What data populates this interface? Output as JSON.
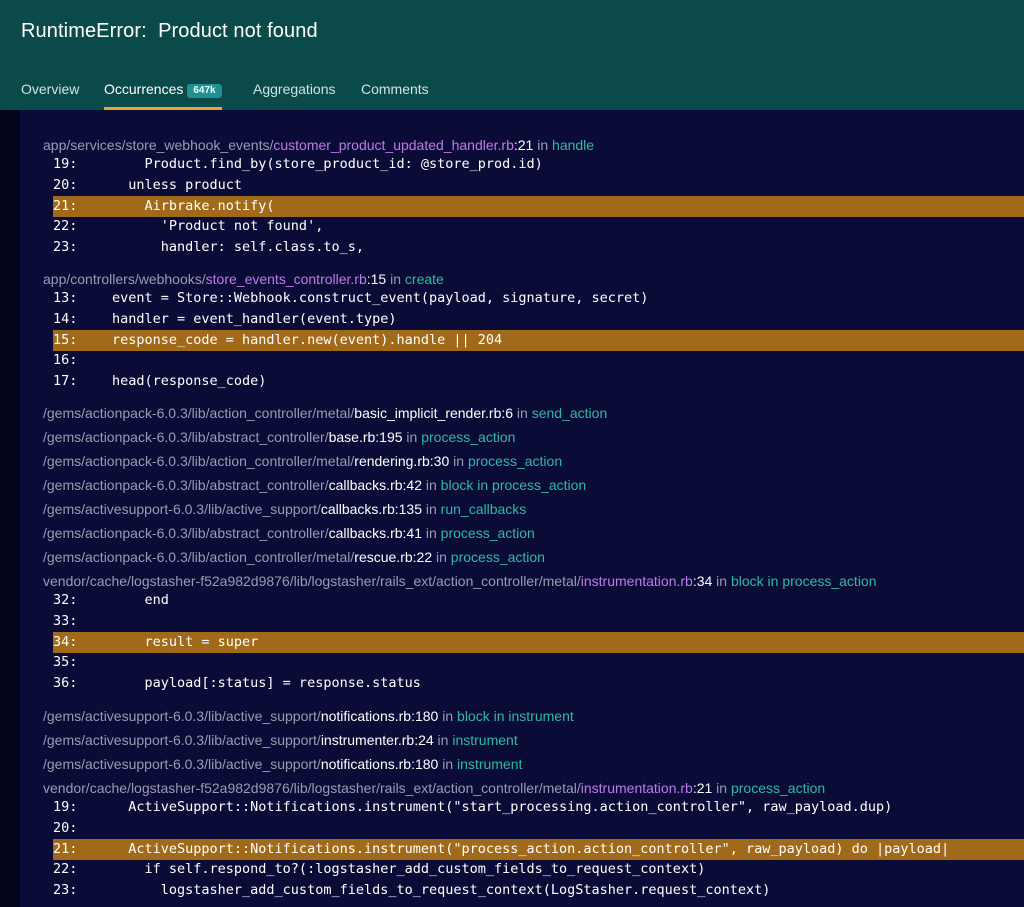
{
  "header": {
    "title": "RuntimeError:  Product not found",
    "tabs": [
      {
        "label": "Overview"
      },
      {
        "label": "Occurrences",
        "badge": "647k"
      },
      {
        "label": "Aggregations"
      },
      {
        "label": "Comments"
      }
    ]
  },
  "frames": [
    {
      "dir": "app/services/store_webhook_events/",
      "file": "customer_product_updated_handler.rb",
      "line": ":21",
      "in": " in ",
      "method": "handle"
    },
    {
      "dir": "app/controllers/webhooks/",
      "file": "store_events_controller.rb",
      "line": ":15",
      "in": " in ",
      "method": "create"
    },
    {
      "dir": "/gems/actionpack-6.0.3/lib/action_controller/metal/",
      "file": "basic_implicit_render.rb",
      "line": ":6",
      "in": " in ",
      "method": "send_action"
    },
    {
      "dir": "/gems/actionpack-6.0.3/lib/abstract_controller/",
      "file": "base.rb",
      "line": ":195",
      "in": " in ",
      "method": "process_action"
    },
    {
      "dir": "/gems/actionpack-6.0.3/lib/action_controller/metal/",
      "file": "rendering.rb",
      "line": ":30",
      "in": " in ",
      "method": "process_action"
    },
    {
      "dir": "/gems/actionpack-6.0.3/lib/abstract_controller/",
      "file": "callbacks.rb",
      "line": ":42",
      "in": " in ",
      "method": "block in process_action"
    },
    {
      "dir": "/gems/activesupport-6.0.3/lib/active_support/",
      "file": "callbacks.rb",
      "line": ":135",
      "in": " in ",
      "method": "run_callbacks"
    },
    {
      "dir": "/gems/actionpack-6.0.3/lib/abstract_controller/",
      "file": "callbacks.rb",
      "line": ":41",
      "in": " in ",
      "method": "process_action"
    },
    {
      "dir": "/gems/actionpack-6.0.3/lib/action_controller/metal/",
      "file": "rescue.rb",
      "line": ":22",
      "in": " in ",
      "method": "process_action"
    },
    {
      "dir": "vendor/cache/logstasher-f52a982d9876/lib/logstasher/rails_ext/action_controller/metal/",
      "file": "instrumentation.rb",
      "line": ":34",
      "in": " in ",
      "method": "block in process_action"
    },
    {
      "dir": "/gems/activesupport-6.0.3/lib/active_support/",
      "file": "notifications.rb",
      "line": ":180",
      "in": " in ",
      "method": "block in instrument"
    },
    {
      "dir": "/gems/activesupport-6.0.3/lib/active_support/",
      "file": "instrumenter.rb",
      "line": ":24",
      "in": " in ",
      "method": "instrument"
    },
    {
      "dir": "/gems/activesupport-6.0.3/lib/active_support/",
      "file": "notifications.rb",
      "line": ":180",
      "in": " in ",
      "method": "instrument"
    },
    {
      "dir": "vendor/cache/logstasher-f52a982d9876/lib/logstasher/rails_ext/action_controller/metal/",
      "file": "instrumentation.rb",
      "line": ":21",
      "in": " in ",
      "method": "process_action"
    }
  ],
  "code_blocks": [
    [
      {
        "num": "19:",
        "code": "    Product.find_by(store_product_id: @store_prod.id)"
      },
      {
        "num": "20:",
        "code": "  unless product"
      },
      {
        "num": "21:",
        "code": "    Airbrake.notify("
      },
      {
        "num": "22:",
        "code": "      'Product not found',"
      },
      {
        "num": "23:",
        "code": "      handler: self.class.to_s,"
      }
    ],
    [
      {
        "num": "13:",
        "code": "event = Store::Webhook.construct_event(payload, signature, secret)"
      },
      {
        "num": "14:",
        "code": "handler = event_handler(event.type)"
      },
      {
        "num": "15:",
        "code": "response_code = handler.new(event).handle || 204"
      },
      {
        "num": "16:",
        "code": ""
      },
      {
        "num": "17:",
        "code": "head(response_code)"
      }
    ],
    [
      {
        "num": "32:",
        "code": "    end"
      },
      {
        "num": "33:",
        "code": ""
      },
      {
        "num": "34:",
        "code": "    result = super"
      },
      {
        "num": "35:",
        "code": ""
      },
      {
        "num": "36:",
        "code": "    payload[:status] = response.status"
      }
    ],
    [
      {
        "num": "19:",
        "code": "  ActiveSupport::Notifications.instrument(\"start_processing.action_controller\", raw_payload.dup)"
      },
      {
        "num": "20:",
        "code": ""
      },
      {
        "num": "21:",
        "code": "  ActiveSupport::Notifications.instrument(\"process_action.action_controller\", raw_payload) do |payload|"
      },
      {
        "num": "22:",
        "code": "    if self.respond_to?(:logstasher_add_custom_fields_to_request_context)"
      },
      {
        "num": "23:",
        "code": "      logstasher_add_custom_fields_to_request_context(LogStasher.request_context)"
      }
    ]
  ]
}
